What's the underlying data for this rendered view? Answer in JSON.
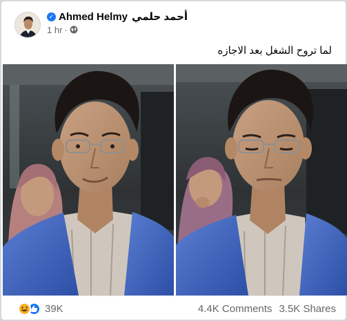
{
  "post": {
    "author_name": "Ahmed Helmy",
    "author_name_arabic": "أحمد حلمي",
    "timestamp": "1 hr",
    "separator": "·",
    "privacy_icon": "globe-icon",
    "verified_icon": "verified-badge-icon",
    "text": "لما تروح الشغل بعد الاجازه"
  },
  "footer": {
    "reaction_icons": [
      "haha-icon",
      "like-icon"
    ],
    "reaction_count": "39K",
    "comments": "4.4K Comments",
    "shares": "3.5K Shares"
  },
  "colors": {
    "facebook_blue": "#1877f2",
    "haha_yellow": "#f7b125",
    "meta_gray": "#65676b"
  }
}
